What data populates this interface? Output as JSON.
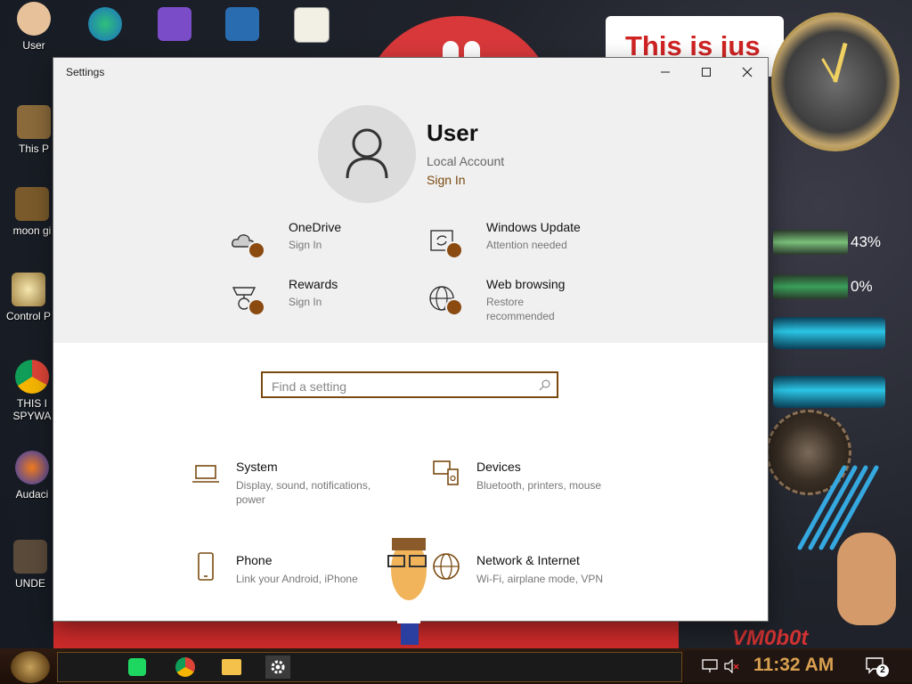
{
  "desktop": {
    "banner_text": "This is jus",
    "gauges": [
      "43%",
      "0%"
    ],
    "watermark": "VM0b0t",
    "icons": [
      {
        "label": "User",
        "name": "user-folder-icon"
      },
      {
        "label": "This P",
        "name": "this-pc-icon"
      },
      {
        "label": "moon gi",
        "name": "moon-icon"
      },
      {
        "label": "Control P",
        "name": "control-panel-icon"
      },
      {
        "label": "THIS I",
        "label2": "SPYWA",
        "name": "chrome-desktop-icon"
      },
      {
        "label": "Audaci",
        "name": "audacity-icon"
      },
      {
        "label": "UNDE",
        "name": "undertale-icon"
      }
    ],
    "top_icons": [
      {
        "label": "",
        "name": "edge-icon"
      },
      {
        "label": "",
        "name": "visual-studio-icon"
      },
      {
        "label": "",
        "name": "virtualbox-icon"
      },
      {
        "label": "",
        "name": "hxd-icon"
      }
    ]
  },
  "window": {
    "title": "Settings",
    "controls": {
      "minimize": "—",
      "maximize": "☐",
      "close": "✕"
    }
  },
  "account": {
    "name": "User",
    "type": "Local Account",
    "sign_in": "Sign In"
  },
  "quick_actions": [
    {
      "title": "OneDrive",
      "sub": "Sign In",
      "icon": "cloud-icon"
    },
    {
      "title": "Windows Update",
      "sub": "Attention needed",
      "icon": "update-icon"
    },
    {
      "title": "Rewards",
      "sub": "Sign In",
      "icon": "rewards-icon"
    },
    {
      "title": "Web browsing",
      "sub": "Restore",
      "sub2": "recommended",
      "icon": "globe-icon"
    }
  ],
  "search": {
    "placeholder": "Find a setting",
    "value": ""
  },
  "categories": [
    {
      "title": "System",
      "sub": "Display, sound, notifications,",
      "sub2": "power",
      "icon": "laptop-icon"
    },
    {
      "title": "Devices",
      "sub": "Bluetooth, printers, mouse",
      "sub2": "",
      "icon": "devices-icon"
    },
    {
      "title": "Phone",
      "sub": "Link your Android, iPhone",
      "sub2": "",
      "icon": "phone-icon"
    },
    {
      "title": "Network & Internet",
      "sub": "Wi-Fi, airplane mode, VPN",
      "sub2": "",
      "icon": "network-globe-icon"
    }
  ],
  "taskbar": {
    "apps": [
      "spotify-like-icon",
      "chrome-icon",
      "file-explorer-icon",
      "settings-gear-icon"
    ],
    "clock": "11:32 AM",
    "notifications_count": "2"
  },
  "colors": {
    "accent": "#7a4a10",
    "badge_dot": "#8a4a10",
    "window_bg": "#ffffff",
    "header_bg": "#f0f0f0"
  }
}
